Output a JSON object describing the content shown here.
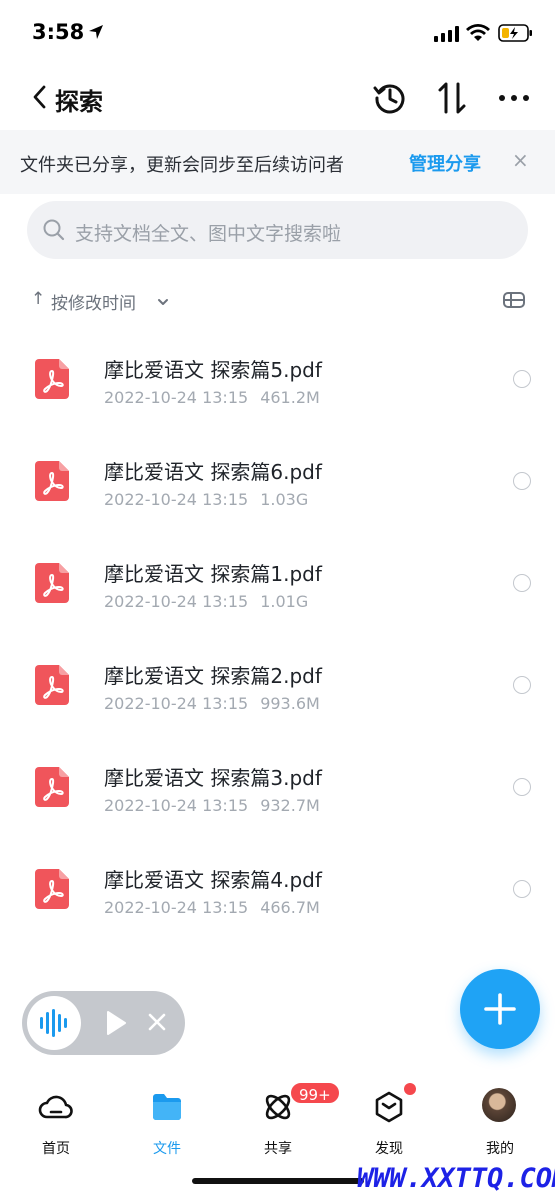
{
  "status_bar": {
    "time": "3:58"
  },
  "nav": {
    "title": "探索"
  },
  "share_banner": {
    "text": "文件夹已分享，更新会同步至后续访问者",
    "link": "管理分享",
    "close": "×"
  },
  "search": {
    "placeholder": "支持文档全文、图中文字搜索啦"
  },
  "sort": {
    "arrow": "↑",
    "label": "按修改时间"
  },
  "files": [
    {
      "name": "摩比爱语文 探索篇5.pdf",
      "date": "2022-10-24 13:15",
      "size": "461.2M"
    },
    {
      "name": "摩比爱语文 探索篇6.pdf",
      "date": "2022-10-24 13:15",
      "size": "1.03G"
    },
    {
      "name": "摩比爱语文 探索篇1.pdf",
      "date": "2022-10-24 13:15",
      "size": "1.01G"
    },
    {
      "name": "摩比爱语文 探索篇2.pdf",
      "date": "2022-10-24 13:15",
      "size": "993.6M"
    },
    {
      "name": "摩比爱语文 探索篇3.pdf",
      "date": "2022-10-24 13:15",
      "size": "932.7M"
    },
    {
      "name": "摩比爱语文 探索篇4.pdf",
      "date": "2022-10-24 13:15",
      "size": "466.7M"
    }
  ],
  "tabs": [
    {
      "label": "首页",
      "icon": "cloud-icon"
    },
    {
      "label": "文件",
      "icon": "folder-icon"
    },
    {
      "label": "共享",
      "icon": "share-atom-icon"
    },
    {
      "label": "发现",
      "icon": "cube-icon"
    },
    {
      "label": "我的",
      "icon": "avatar"
    }
  ],
  "badges": {
    "share_count": "99+"
  },
  "colors": {
    "accent": "#1b9aee",
    "fab": "#1fa3f5",
    "badge": "#f5484d",
    "pdf": "#f0555b"
  },
  "watermark": "WWW.XXTTQ.COM"
}
